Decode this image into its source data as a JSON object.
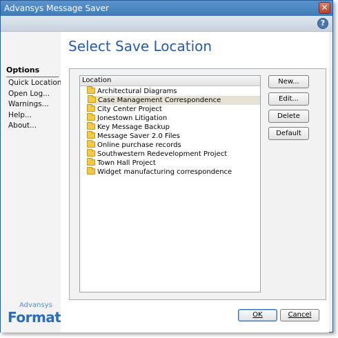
{
  "window": {
    "title": "Advansys Message Saver"
  },
  "sidebar": {
    "heading": "Options",
    "links": [
      "Quick Location...",
      "Open Log...",
      "Warnings...",
      "Help...",
      "About..."
    ],
    "brand_top": "Advansys",
    "brand_name": "Formativ"
  },
  "main": {
    "title": "Select Save Location",
    "list_header": "Location",
    "selected_index": 1,
    "items": [
      "Architectural Diagrams",
      "Case Management Correspondence",
      "City Center Project",
      "Jonestown Litigation",
      "Key Message Backup",
      "Message Saver 2.0 Files",
      "Online purchase records",
      "Southwestern Redevelopment Project",
      "Town Hall Project",
      "Widget manufacturing correspondence"
    ],
    "buttons": {
      "new": "New...",
      "edit": "Edit...",
      "delete": "Delete",
      "default": "Default"
    }
  },
  "footer": {
    "ok": "OK",
    "cancel": "Cancel"
  },
  "icons": {
    "close": "close-icon",
    "help": "help-icon",
    "folder": "folder-icon"
  },
  "colors": {
    "title_bar": "#3e7ab8",
    "page_title": "#2a5aa0",
    "brand": "#2c6db7",
    "selection": "#e6e2d6"
  }
}
